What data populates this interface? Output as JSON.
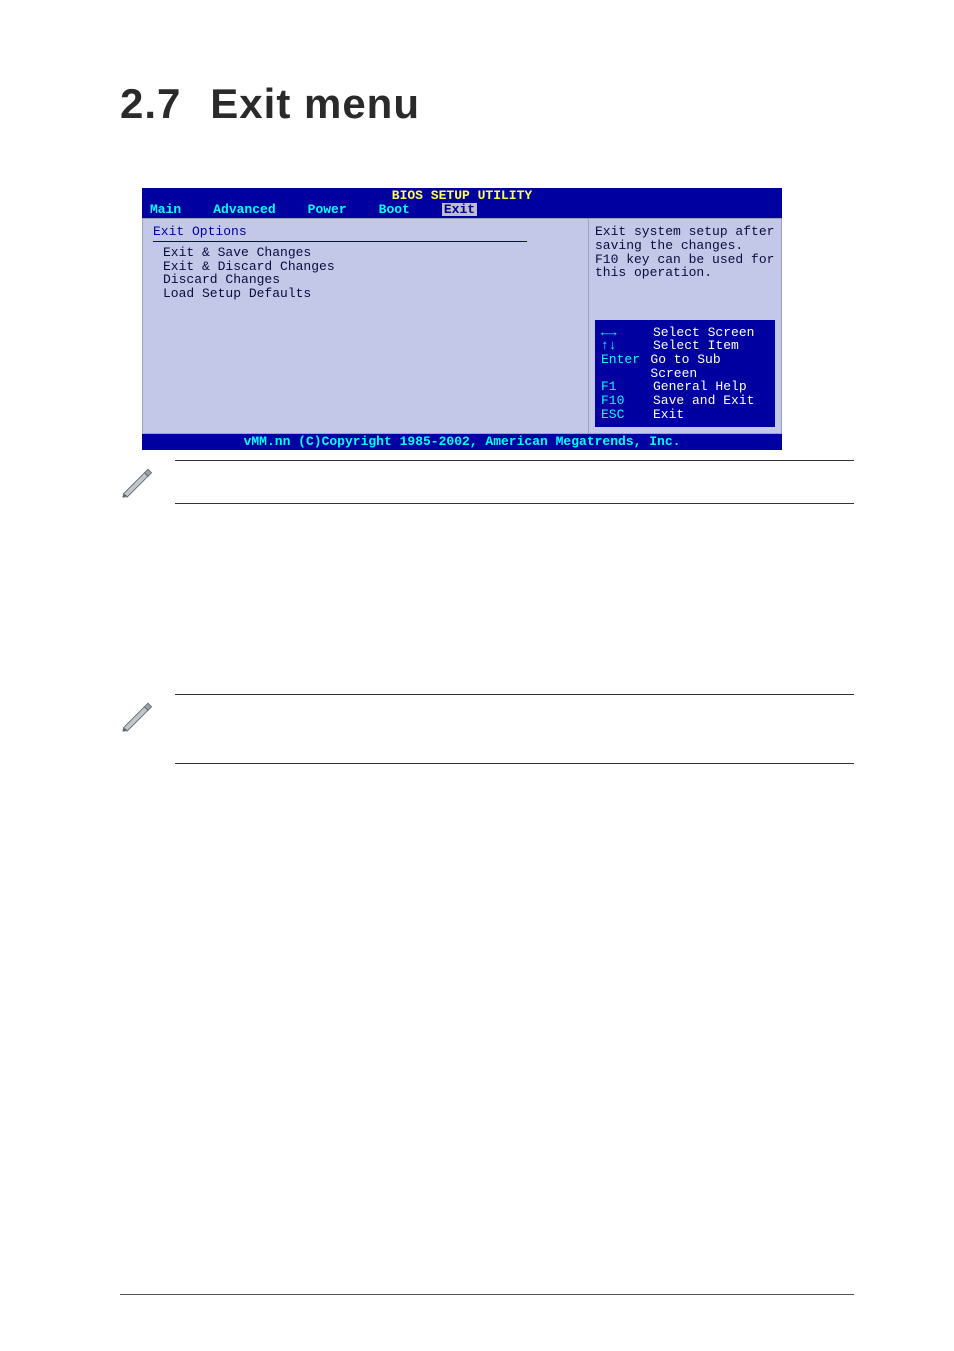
{
  "heading": {
    "number": "2.7",
    "title": "Exit menu"
  },
  "bios": {
    "utility_title": "BIOS SETUP UTILITY",
    "menus": [
      "Main",
      "Advanced",
      "Power",
      "Boot",
      "Exit"
    ],
    "selected_menu": "Exit",
    "left": {
      "header": "Exit Options",
      "options": [
        "Exit & Save Changes",
        "Exit & Discard Changes",
        "Discard Changes",
        "",
        "Load Setup Defaults"
      ]
    },
    "right": {
      "help_lines": [
        "Exit system setup after",
        "saving the changes.",
        "",
        "F10 key can be used for",
        "this operation."
      ],
      "nav": [
        {
          "key": "←→",
          "action": "Select Screen"
        },
        {
          "key": "↑↓",
          "action": "Select Item"
        },
        {
          "key": "Enter",
          "action": "Go to Sub Screen"
        },
        {
          "key": "F1",
          "action": "General Help"
        },
        {
          "key": "F10",
          "action": "Save and Exit"
        },
        {
          "key": "ESC",
          "action": "Exit"
        }
      ]
    },
    "footer": "vMM.nn (C)Copyright 1985-2002, American Megatrends, Inc."
  },
  "notes": {
    "note1": "",
    "note2": ""
  }
}
